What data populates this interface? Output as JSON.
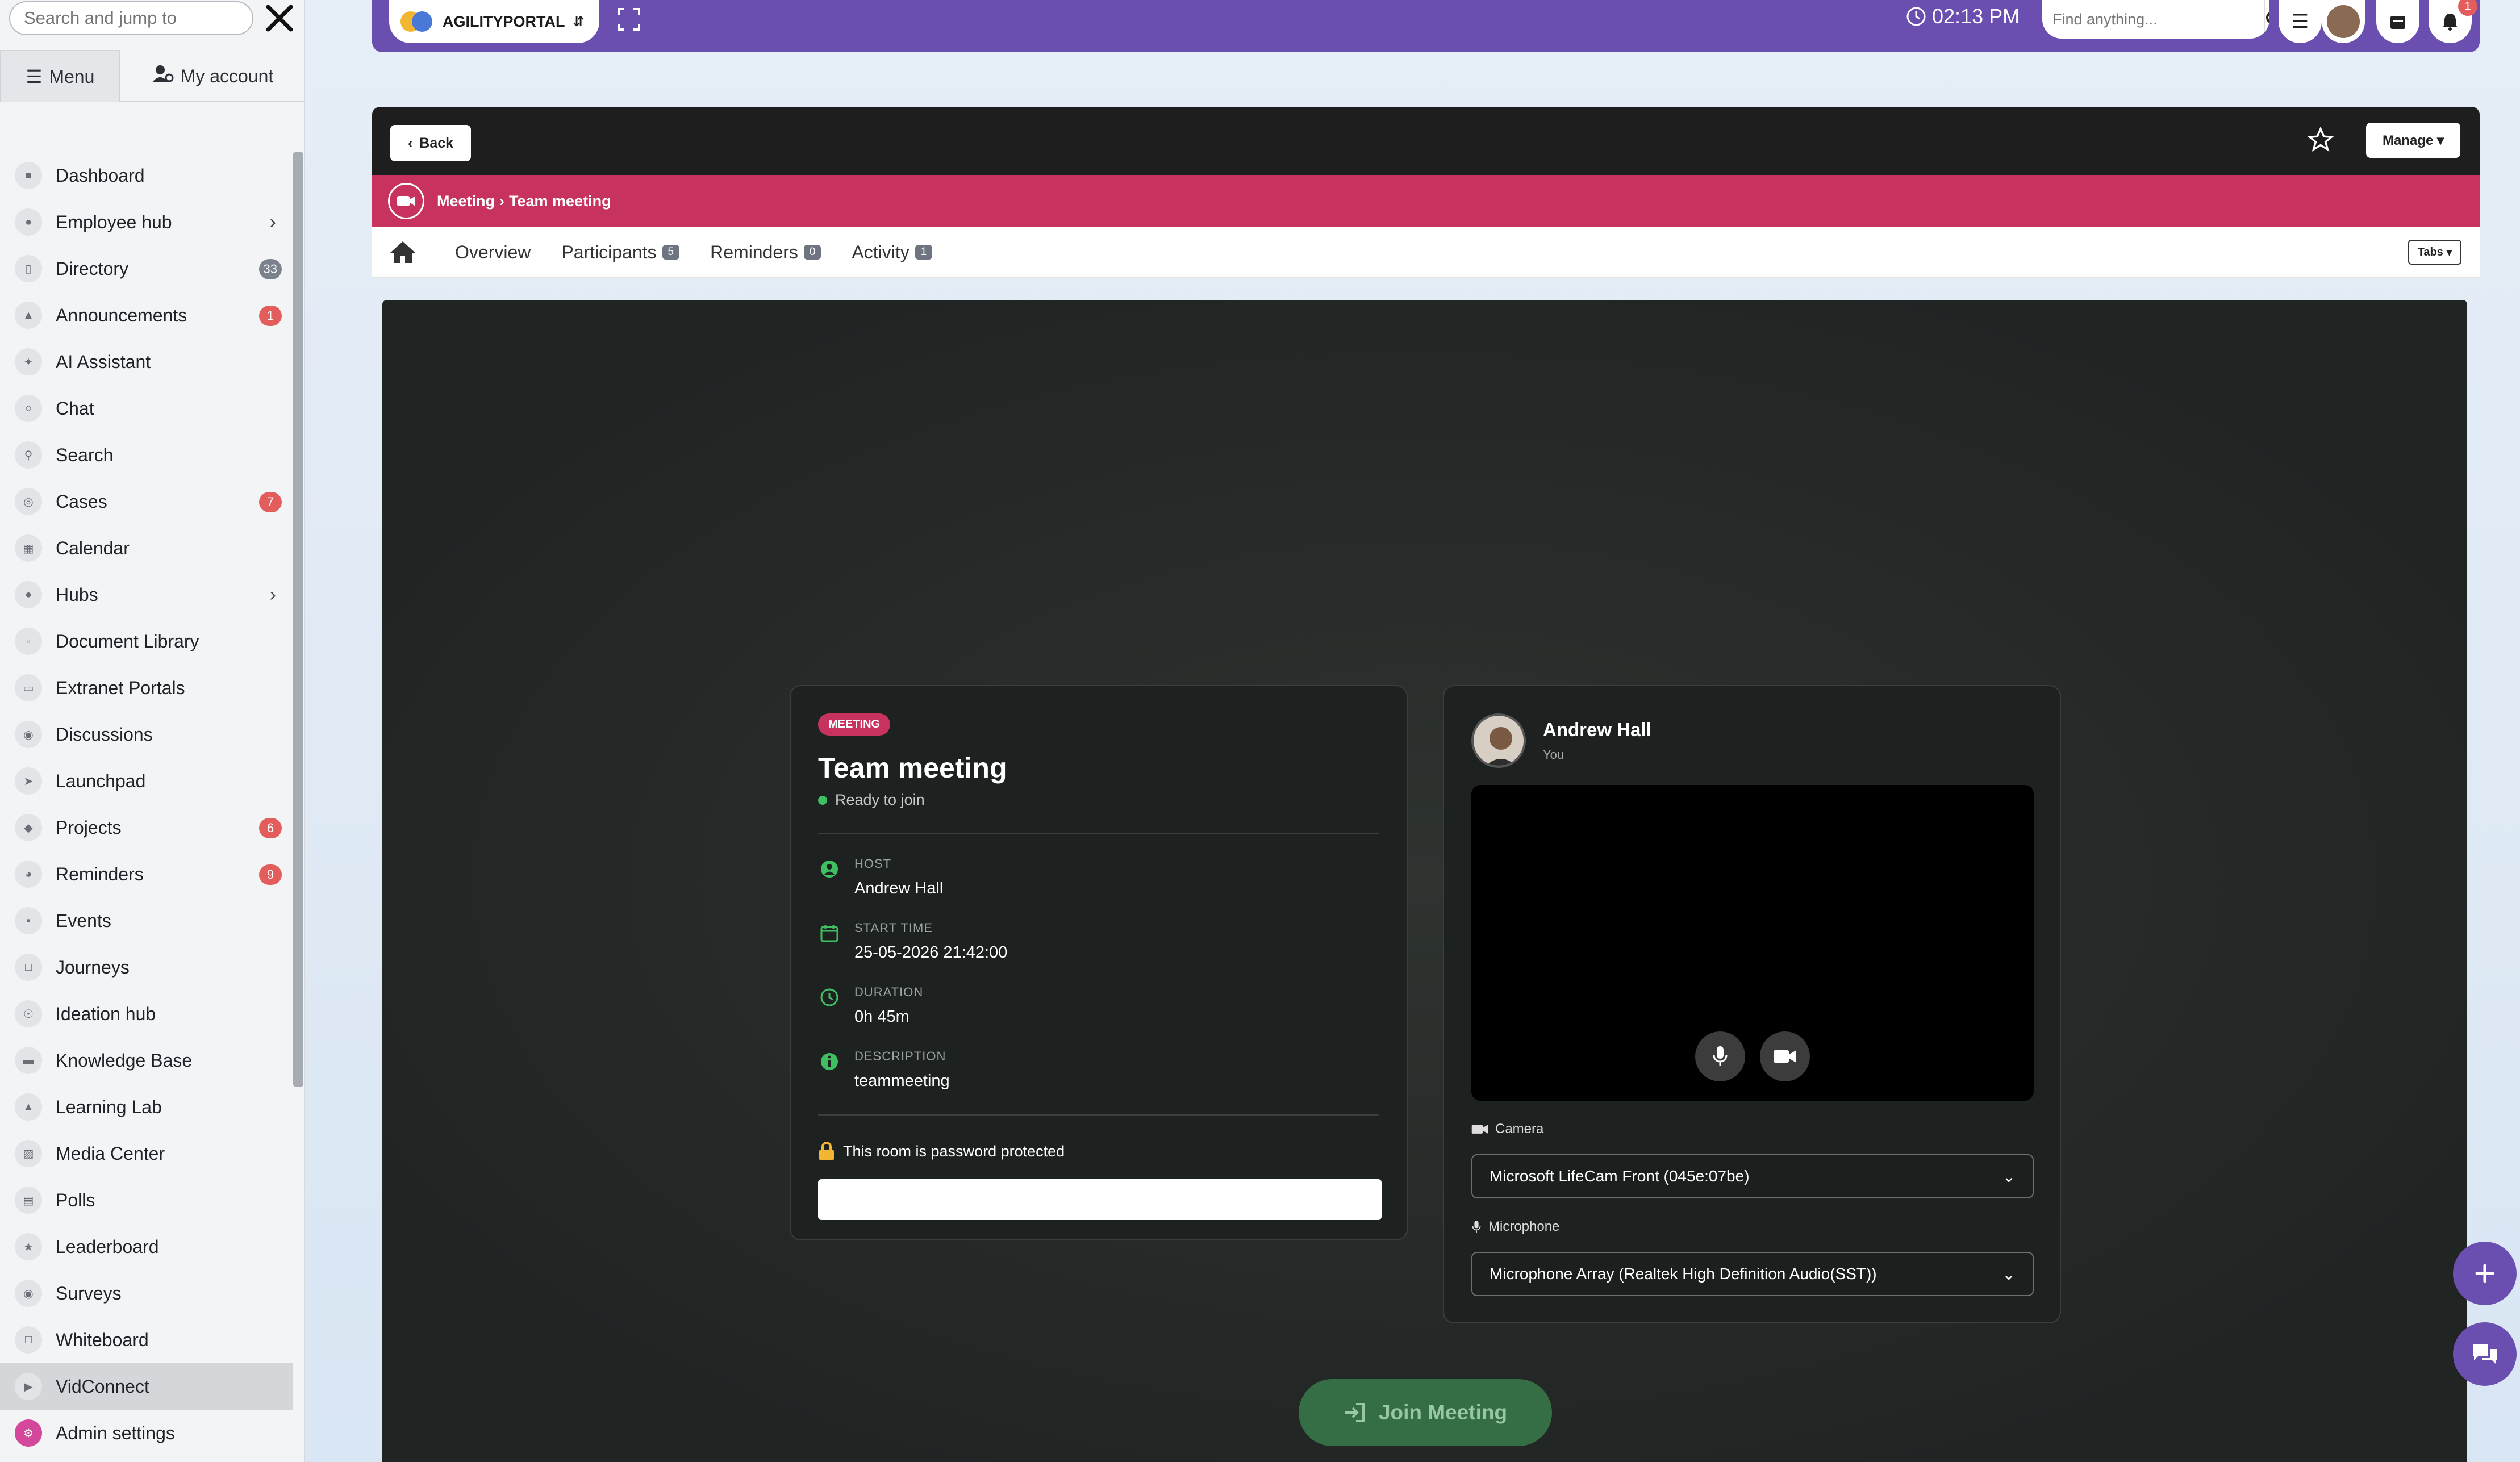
{
  "sidebar": {
    "search_placeholder": "Search and jump to",
    "tab_menu": "Menu",
    "tab_account": "My account",
    "items": [
      {
        "label": "Dashboard"
      },
      {
        "label": "Employee hub",
        "chevron": true
      },
      {
        "label": "Directory",
        "badge": "33",
        "badge_color": "gray"
      },
      {
        "label": "Announcements",
        "badge": "1"
      },
      {
        "label": "AI Assistant"
      },
      {
        "label": "Chat"
      },
      {
        "label": "Search"
      },
      {
        "label": "Cases",
        "badge": "7"
      },
      {
        "label": "Calendar"
      },
      {
        "label": "Hubs",
        "chevron": true
      },
      {
        "label": "Document Library"
      },
      {
        "label": "Extranet Portals"
      },
      {
        "label": "Discussions"
      },
      {
        "label": "Launchpad"
      },
      {
        "label": "Projects",
        "badge": "6"
      },
      {
        "label": "Reminders",
        "badge": "9"
      },
      {
        "label": "Events"
      },
      {
        "label": "Journeys"
      },
      {
        "label": "Ideation hub"
      },
      {
        "label": "Knowledge Base"
      },
      {
        "label": "Learning Lab"
      },
      {
        "label": "Media Center"
      },
      {
        "label": "Polls"
      },
      {
        "label": "Leaderboard"
      },
      {
        "label": "Surveys"
      },
      {
        "label": "Whiteboard"
      },
      {
        "label": "VidConnect",
        "active": true
      },
      {
        "label": "Admin settings",
        "admin": true
      }
    ]
  },
  "topbar": {
    "brand": "AGILITYPORTAL",
    "time": "02:13 PM",
    "find_placeholder": "Find anything...",
    "notification_count": "1",
    "accent": "#6b4fb0"
  },
  "panel": {
    "back_label": "Back",
    "manage_label": "Manage",
    "breadcrumb": [
      "Meeting",
      "Team meeting"
    ],
    "tabs": [
      {
        "label": "Overview"
      },
      {
        "label": "Participants",
        "badge": "5"
      },
      {
        "label": "Reminders",
        "badge": "0"
      },
      {
        "label": "Activity",
        "badge": "1"
      }
    ],
    "tabs_dropdown": "Tabs",
    "crumb_color": "#c8325e"
  },
  "meeting": {
    "pill": "MEETING",
    "title": "Team meeting",
    "status": "Ready to join",
    "host_label": "HOST",
    "host": "Andrew Hall",
    "start_label": "START TIME",
    "start": "25-05-2026 21:42:00",
    "duration_label": "DURATION",
    "duration": "0h 45m",
    "description_label": "DESCRIPTION",
    "description": "teammeeting",
    "password_note": "This room is password protected",
    "password_value": ""
  },
  "device": {
    "user_name": "Andrew Hall",
    "user_sub": "You",
    "camera_label": "Camera",
    "camera_value": "Microsoft LifeCam Front (045e:07be)",
    "mic_label": "Microphone",
    "mic_value": "Microphone Array (Realtek High Definition Audio(SST))"
  },
  "join_label": "Join Meeting"
}
